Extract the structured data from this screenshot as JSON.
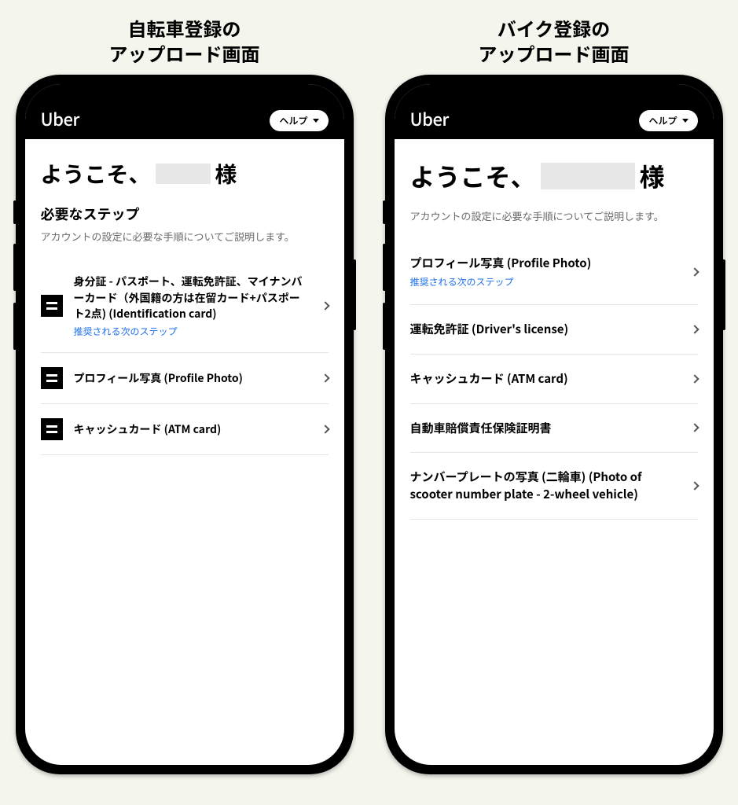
{
  "left": {
    "caption_line1": "自転車登録の",
    "caption_line2": "アップロード画面",
    "logo": "Uber",
    "help_label": "ヘルプ",
    "welcome_prefix": "ようこそ、",
    "welcome_suffix": "様",
    "section_title": "必要なステップ",
    "section_sub": "アカウントの設定に必要な手順についてご説明します。",
    "steps": [
      {
        "label": "身分証 - パスポート、運転免許証、マイナンバーカード（外国籍の方は在留カード+パスポート2点) (Identification card)",
        "hint": "推奨される次のステップ"
      },
      {
        "label": "プロフィール写真 (Profile Photo)"
      },
      {
        "label": "キャッシュカード (ATM card)"
      }
    ]
  },
  "right": {
    "caption_line1": "バイク登録の",
    "caption_line2": "アップロード画面",
    "logo": "Uber",
    "help_label": "ヘルプ",
    "welcome_prefix": "ようこそ、",
    "welcome_suffix": "様",
    "section_sub": "アカウントの設定に必要な手順についてご説明します。",
    "steps": [
      {
        "label": "プロフィール写真 (Profile Photo)",
        "hint": "推奨される次のステップ"
      },
      {
        "label": "運転免許証 (Driver's license)"
      },
      {
        "label": "キャッシュカード (ATM card)"
      },
      {
        "label": "自動車賠償責任保険証明書"
      },
      {
        "label": "ナンバープレートの写真 (二輪車) (Photo of scooter number plate - 2-wheel vehicle)"
      }
    ]
  }
}
